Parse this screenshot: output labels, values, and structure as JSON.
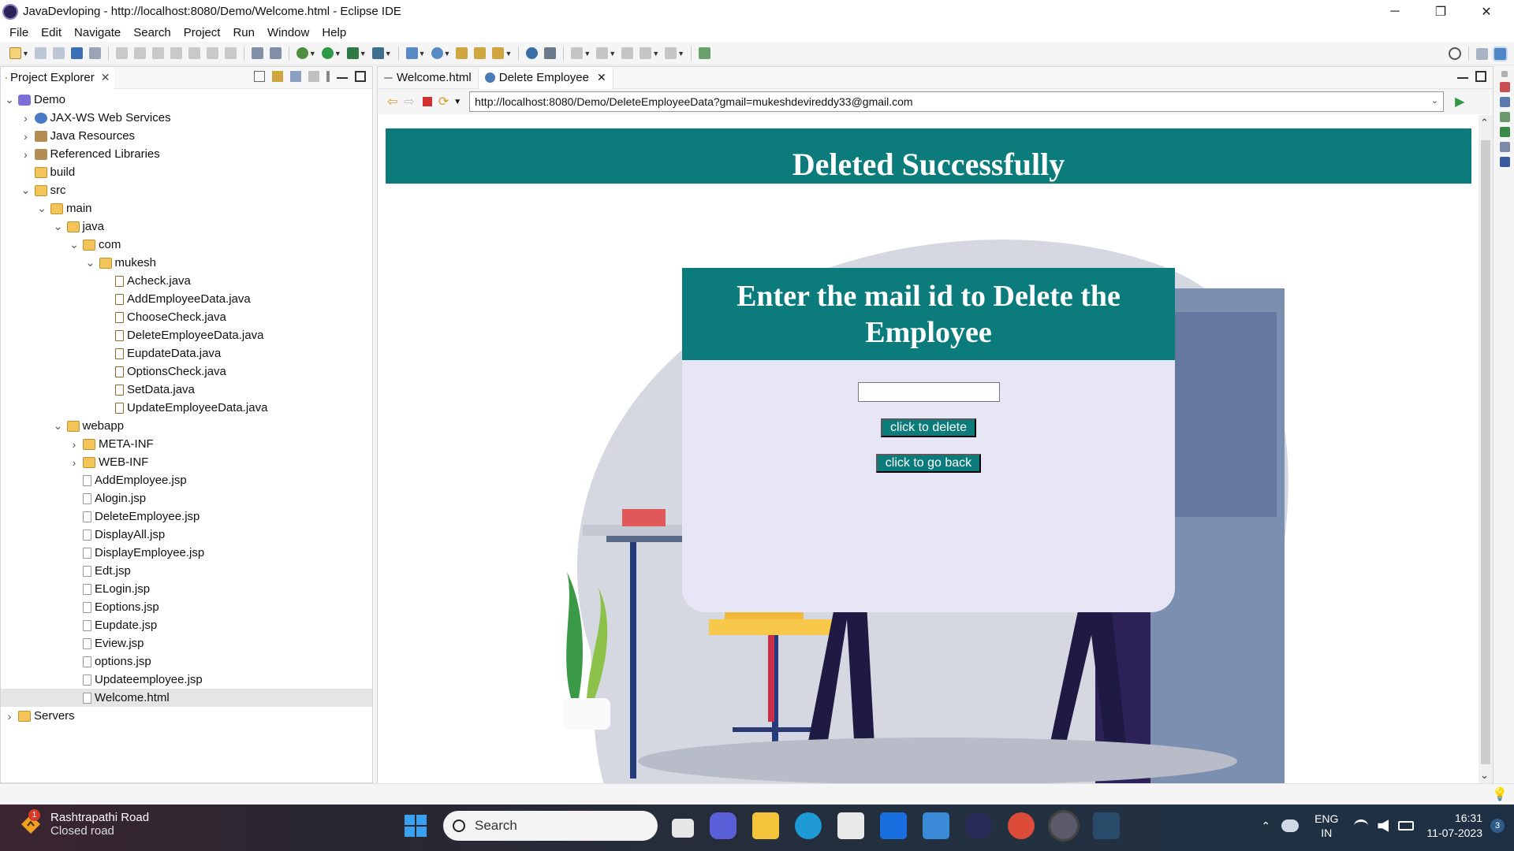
{
  "window": {
    "title": "JavaDevloping - http://localhost:8080/Demo/Welcome.html - Eclipse IDE",
    "minimize": "─",
    "restore": "❐",
    "close": "✕"
  },
  "menu": [
    "File",
    "Edit",
    "Navigate",
    "Search",
    "Project",
    "Run",
    "Window",
    "Help"
  ],
  "project_explorer": {
    "tab_label": "Project Explorer",
    "tree": [
      {
        "label": "Demo",
        "depth": 0,
        "expanded": true,
        "icon": "project-icon"
      },
      {
        "label": "JAX-WS Web Services",
        "depth": 1,
        "expanded": false,
        "icon": "web-services-icon"
      },
      {
        "label": "Java Resources",
        "depth": 1,
        "expanded": false,
        "icon": "java-resources-icon"
      },
      {
        "label": "Referenced Libraries",
        "depth": 1,
        "expanded": false,
        "icon": "library-icon"
      },
      {
        "label": "build",
        "depth": 1,
        "leaf": true,
        "icon": "folder-icon"
      },
      {
        "label": "src",
        "depth": 1,
        "expanded": true,
        "icon": "folder-icon"
      },
      {
        "label": "main",
        "depth": 2,
        "expanded": true,
        "icon": "folder-icon"
      },
      {
        "label": "java",
        "depth": 3,
        "expanded": true,
        "icon": "folder-icon"
      },
      {
        "label": "com",
        "depth": 4,
        "expanded": true,
        "icon": "folder-icon"
      },
      {
        "label": "mukesh",
        "depth": 5,
        "expanded": true,
        "icon": "folder-icon"
      },
      {
        "label": "Acheck.java",
        "depth": 6,
        "leaf": true,
        "icon": "java-file-icon"
      },
      {
        "label": "AddEmployeeData.java",
        "depth": 6,
        "leaf": true,
        "icon": "java-file-icon"
      },
      {
        "label": "ChooseCheck.java",
        "depth": 6,
        "leaf": true,
        "icon": "java-file-icon"
      },
      {
        "label": "DeleteEmployeeData.java",
        "depth": 6,
        "leaf": true,
        "icon": "java-file-icon"
      },
      {
        "label": "EupdateData.java",
        "depth": 6,
        "leaf": true,
        "icon": "java-file-icon"
      },
      {
        "label": "OptionsCheck.java",
        "depth": 6,
        "leaf": true,
        "icon": "java-file-icon"
      },
      {
        "label": "SetData.java",
        "depth": 6,
        "leaf": true,
        "icon": "java-file-icon"
      },
      {
        "label": "UpdateEmployeeData.java",
        "depth": 6,
        "leaf": true,
        "icon": "java-file-icon"
      },
      {
        "label": "webapp",
        "depth": 3,
        "expanded": true,
        "icon": "folder-icon"
      },
      {
        "label": "META-INF",
        "depth": 4,
        "expanded": false,
        "icon": "folder-icon"
      },
      {
        "label": "WEB-INF",
        "depth": 4,
        "expanded": false,
        "icon": "folder-icon"
      },
      {
        "label": "AddEmployee.jsp",
        "depth": 4,
        "leaf": true,
        "icon": "jsp-file-icon"
      },
      {
        "label": "Alogin.jsp",
        "depth": 4,
        "leaf": true,
        "icon": "jsp-file-icon"
      },
      {
        "label": "DeleteEmployee.jsp",
        "depth": 4,
        "leaf": true,
        "icon": "jsp-file-icon"
      },
      {
        "label": "DisplayAll.jsp",
        "depth": 4,
        "leaf": true,
        "icon": "jsp-file-icon"
      },
      {
        "label": "DisplayEmployee.jsp",
        "depth": 4,
        "leaf": true,
        "icon": "jsp-file-icon"
      },
      {
        "label": "Edt.jsp",
        "depth": 4,
        "leaf": true,
        "icon": "jsp-file-icon"
      },
      {
        "label": "ELogin.jsp",
        "depth": 4,
        "leaf": true,
        "icon": "jsp-file-icon"
      },
      {
        "label": "Eoptions.jsp",
        "depth": 4,
        "leaf": true,
        "icon": "jsp-file-icon"
      },
      {
        "label": "Eupdate.jsp",
        "depth": 4,
        "leaf": true,
        "icon": "jsp-file-icon"
      },
      {
        "label": "Eview.jsp",
        "depth": 4,
        "leaf": true,
        "icon": "jsp-file-icon"
      },
      {
        "label": "options.jsp",
        "depth": 4,
        "leaf": true,
        "icon": "jsp-file-icon"
      },
      {
        "label": "Updateemployee.jsp",
        "depth": 4,
        "leaf": true,
        "icon": "jsp-file-icon"
      },
      {
        "label": "Welcome.html",
        "depth": 4,
        "leaf": true,
        "icon": "html-file-icon",
        "selected": true
      },
      {
        "label": "Servers",
        "depth": 0,
        "expanded": false,
        "icon": "folder-icon"
      }
    ]
  },
  "editor": {
    "tabs": [
      {
        "label": "Welcome.html",
        "active": false
      },
      {
        "label": "Delete Employee",
        "active": true
      }
    ],
    "url": "http://localhost:8080/Demo/DeleteEmployeeData?gmail=mukeshdevireddy33@gmail.com"
  },
  "webpage": {
    "banner": "Deleted Successfully",
    "card_heading": "Enter the mail id to Delete the Employee",
    "email_value": "",
    "delete_button": "click to delete",
    "back_button": "click to go back"
  },
  "taskbar": {
    "weather_title": "Rashtrapathi Road",
    "weather_status": "Closed road",
    "weather_badge": "1",
    "search_placeholder": "Search",
    "lang_line1": "ENG",
    "lang_line2": "IN",
    "time": "16:31",
    "date": "11-07-2023",
    "notification_count": "3"
  },
  "colors": {
    "teal": "#0b7b7b",
    "card_bg": "#e6e6f7"
  }
}
